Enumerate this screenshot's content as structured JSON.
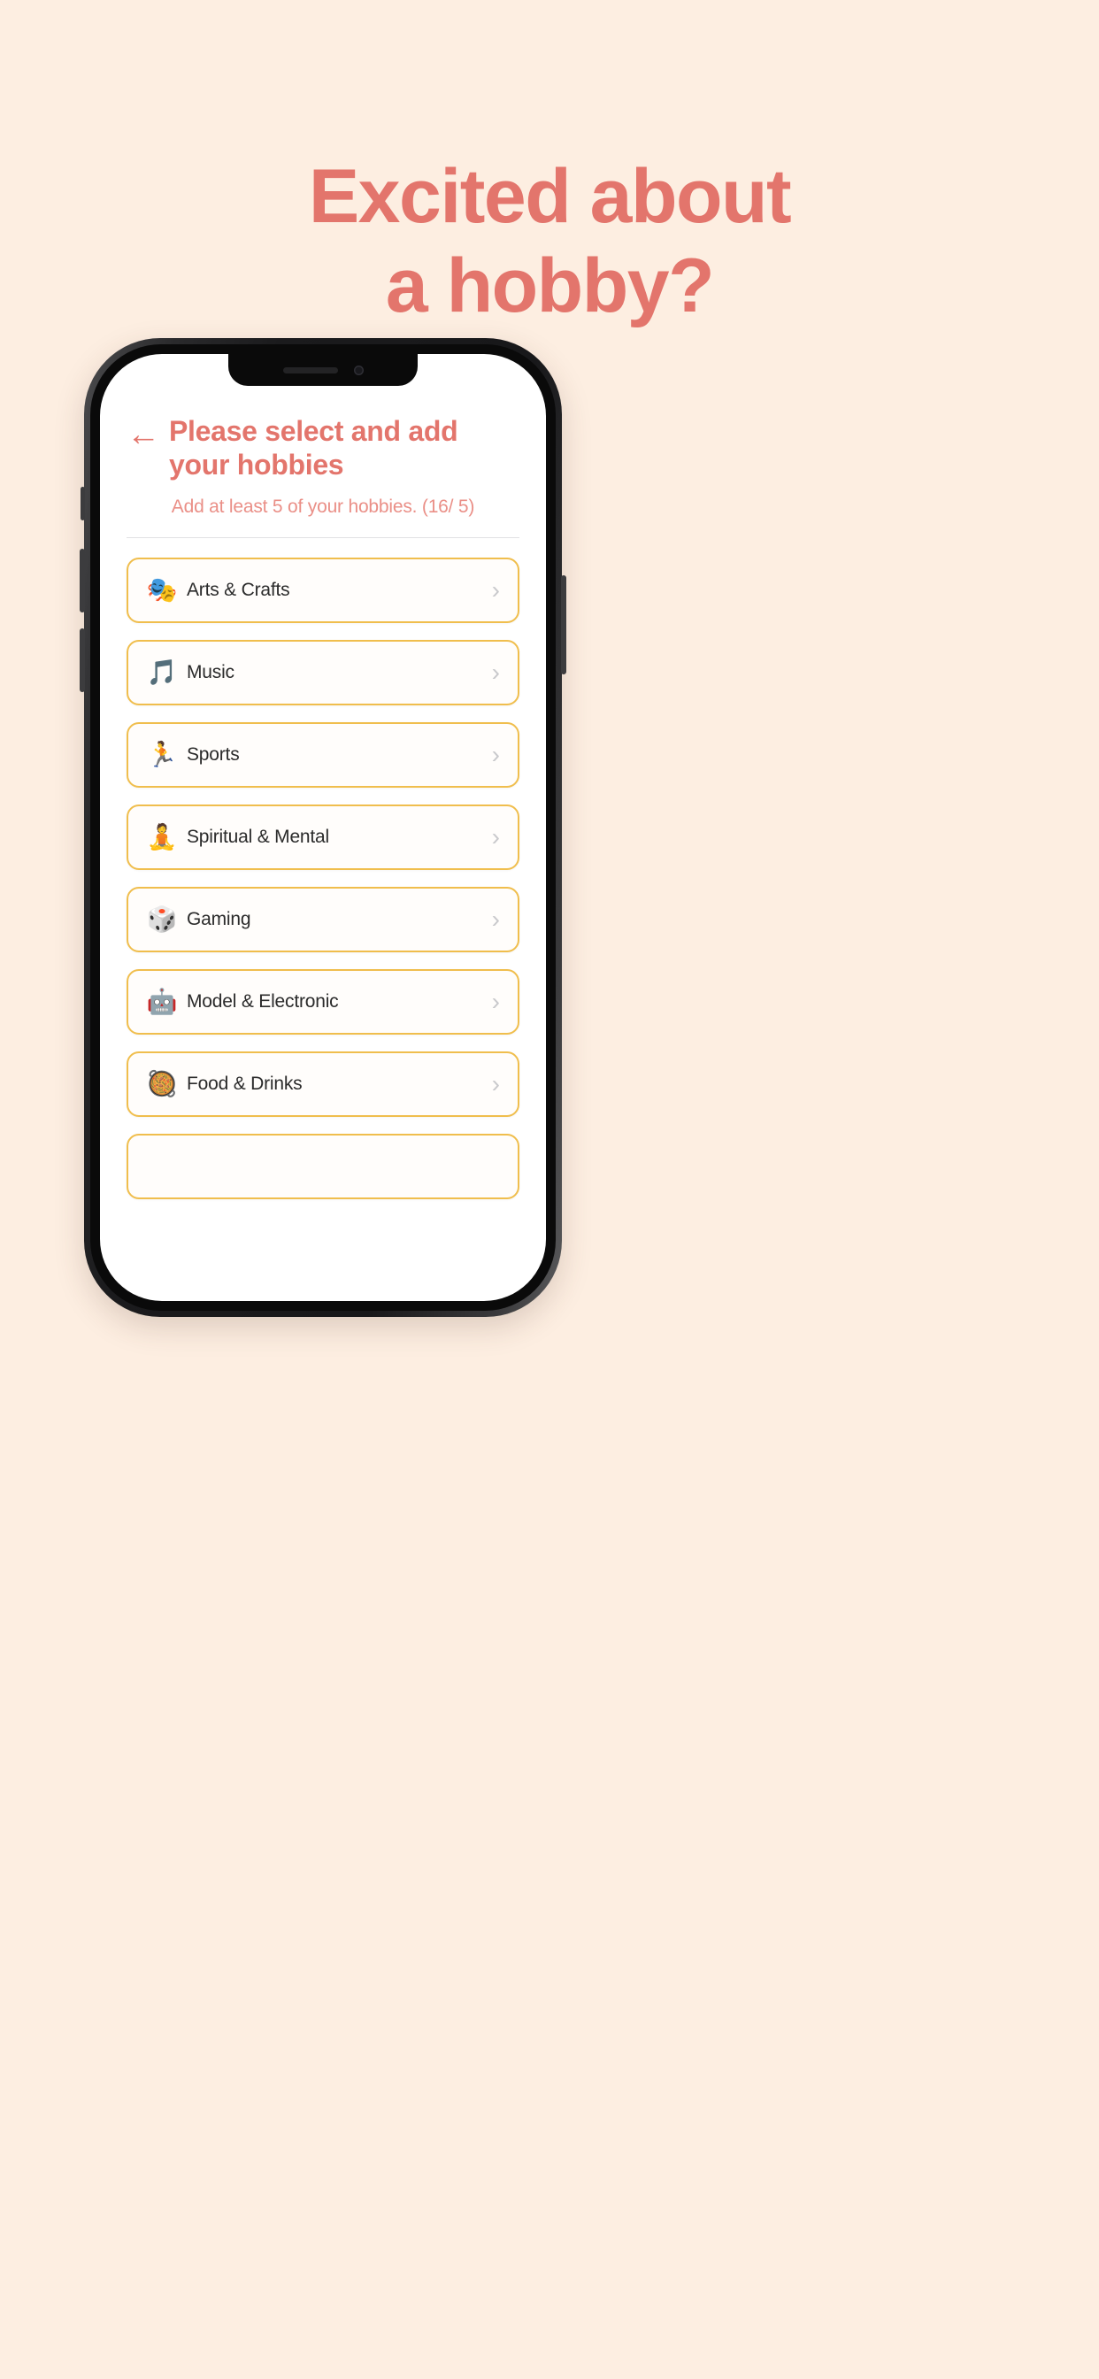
{
  "promo": {
    "background_color": "#fdeee1",
    "accent_color": "#e3756c",
    "headline_line1": "Excited about",
    "headline_line2": "a hobby?"
  },
  "phone_screen": {
    "status": {
      "notch_speaker": "speaker-grill",
      "notch_camera": "front-camera"
    },
    "nav": {
      "back_icon": "←",
      "title": "Please select and add your hobbies"
    },
    "subtitle": "Add at least 5 of your hobbies. (16/ 5)",
    "card_border_color": "#f0be4d",
    "chevron_icon": "›",
    "hobbies": [
      {
        "emoji": "🎭",
        "icon_name": "performing-arts-emoji",
        "label": "Arts & Crafts"
      },
      {
        "emoji": "🎵",
        "icon_name": "musical-note-emoji",
        "label": "Music"
      },
      {
        "emoji": "🏃",
        "icon_name": "runner-emoji",
        "label": "Sports"
      },
      {
        "emoji": "🧘",
        "icon_name": "lotus-position-emoji",
        "label": "Spiritual & Mental"
      },
      {
        "emoji": "🎲",
        "icon_name": "game-die-emoji",
        "label": "Gaming"
      },
      {
        "emoji": "🤖",
        "icon_name": "robot-emoji",
        "label": "Model & Electronic"
      },
      {
        "emoji": "🥘",
        "icon_name": "paella-emoji",
        "label": "Food & Drinks"
      },
      {
        "emoji": "",
        "icon_name": "partial-card",
        "label": ""
      }
    ]
  }
}
